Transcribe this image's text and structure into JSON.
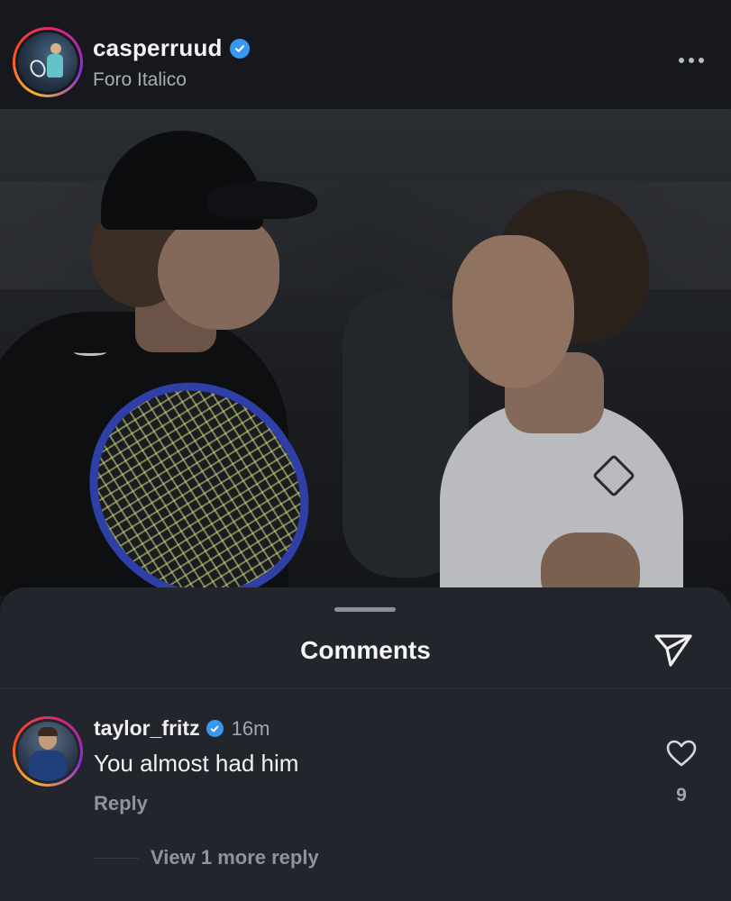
{
  "post": {
    "username": "casperruud",
    "location": "Foro Italico",
    "avatar_icon": "profile-photo",
    "verified_icon": "verified-badge-icon",
    "more_icon": "more-options-icon"
  },
  "photo": {
    "kind": "tennis-players-photo"
  },
  "comments_sheet": {
    "title": "Comments",
    "share_icon": "send-icon",
    "comments": [
      {
        "username": "taylor_fritz",
        "verified": true,
        "time": "16m",
        "text": "You almost had him",
        "reply_label": "Reply",
        "like_icon": "heart-icon",
        "like_count": "9",
        "view_replies_label": "View 1 more reply"
      }
    ]
  },
  "colors": {
    "background": "#15171c",
    "sheet": "#23252c",
    "verified_blue": "#3897f0",
    "muted_text": "#a3a7ad"
  }
}
